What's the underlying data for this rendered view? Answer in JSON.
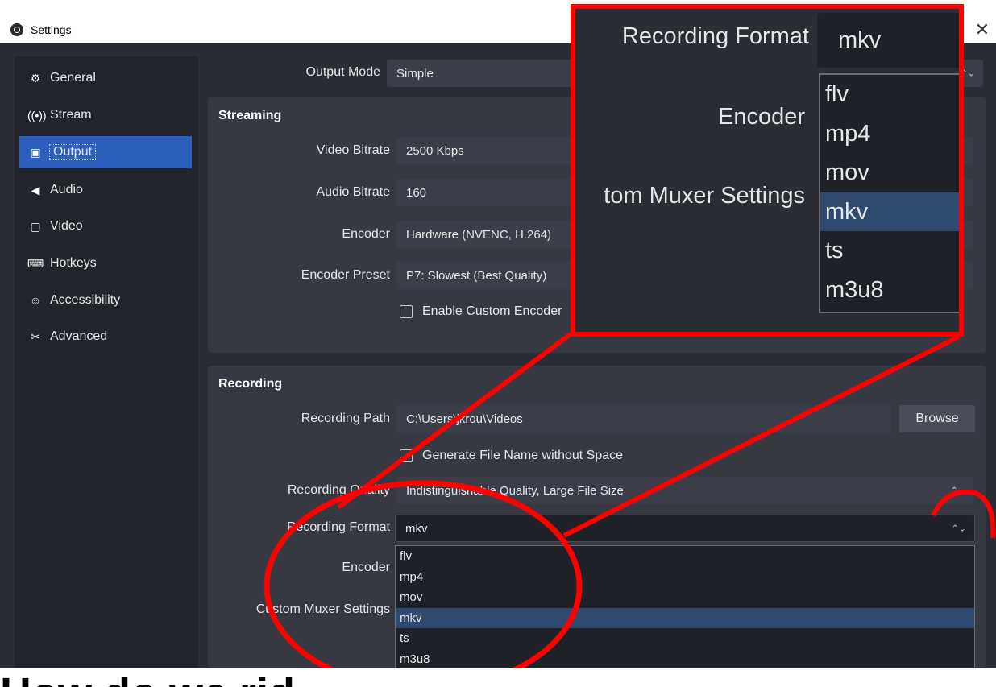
{
  "window": {
    "title": "Settings",
    "close_glyph": "✕"
  },
  "sidebar": {
    "items": [
      {
        "label": "General",
        "icon": "gear-icon",
        "glyph": "⚙"
      },
      {
        "label": "Stream",
        "icon": "antenna-icon",
        "glyph": "📶"
      },
      {
        "label": "Output",
        "icon": "output-icon",
        "glyph": "▣"
      },
      {
        "label": "Audio",
        "icon": "speaker-icon",
        "glyph": "◀"
      },
      {
        "label": "Video",
        "icon": "monitor-icon",
        "glyph": "▢"
      },
      {
        "label": "Hotkeys",
        "icon": "keyboard-icon",
        "glyph": "⌨"
      },
      {
        "label": "Accessibility",
        "icon": "accessibility-icon",
        "glyph": "☺"
      },
      {
        "label": "Advanced",
        "icon": "tools-icon",
        "glyph": "✂"
      }
    ],
    "active": "Output"
  },
  "output_mode": {
    "label": "Output Mode",
    "value": "Simple"
  },
  "streaming": {
    "title": "Streaming",
    "video_bitrate": {
      "label": "Video Bitrate",
      "value": "2500 Kbps"
    },
    "audio_bitrate": {
      "label": "Audio Bitrate",
      "value": "160"
    },
    "encoder": {
      "label": "Encoder",
      "value": "Hardware (NVENC, H.264)"
    },
    "encoder_preset": {
      "label": "Encoder Preset",
      "value": "P7: Slowest (Best Quality)"
    },
    "custom_encoder": {
      "label": "Enable Custom Encoder"
    }
  },
  "recording": {
    "title": "Recording",
    "path": {
      "label": "Recording Path",
      "value": "C:\\Users\\jkrou\\Videos"
    },
    "browse_label": "Browse",
    "no_space": {
      "label": "Generate File Name without Space"
    },
    "quality": {
      "label": "Recording Quality",
      "value": "Indistinguishable Quality, Large File Size"
    },
    "format": {
      "label": "Recording Format",
      "value": "mkv"
    },
    "encoder_label": "Encoder",
    "muxer_label": "Custom Muxer Settings",
    "format_options": [
      "flv",
      "mp4",
      "mov",
      "mkv",
      "ts",
      "m3u8"
    ],
    "selected_option": "mkv"
  },
  "zoom": {
    "format_label": "Recording Format",
    "format_value": "mkv",
    "encoder_label": "Encoder",
    "muxer_label": "tom Muxer Settings",
    "options": [
      "flv",
      "mp4",
      "mov",
      "mkv",
      "ts",
      "m3u8"
    ]
  },
  "annotation_color": "#ff0000",
  "bottom_text": "How do we rid"
}
